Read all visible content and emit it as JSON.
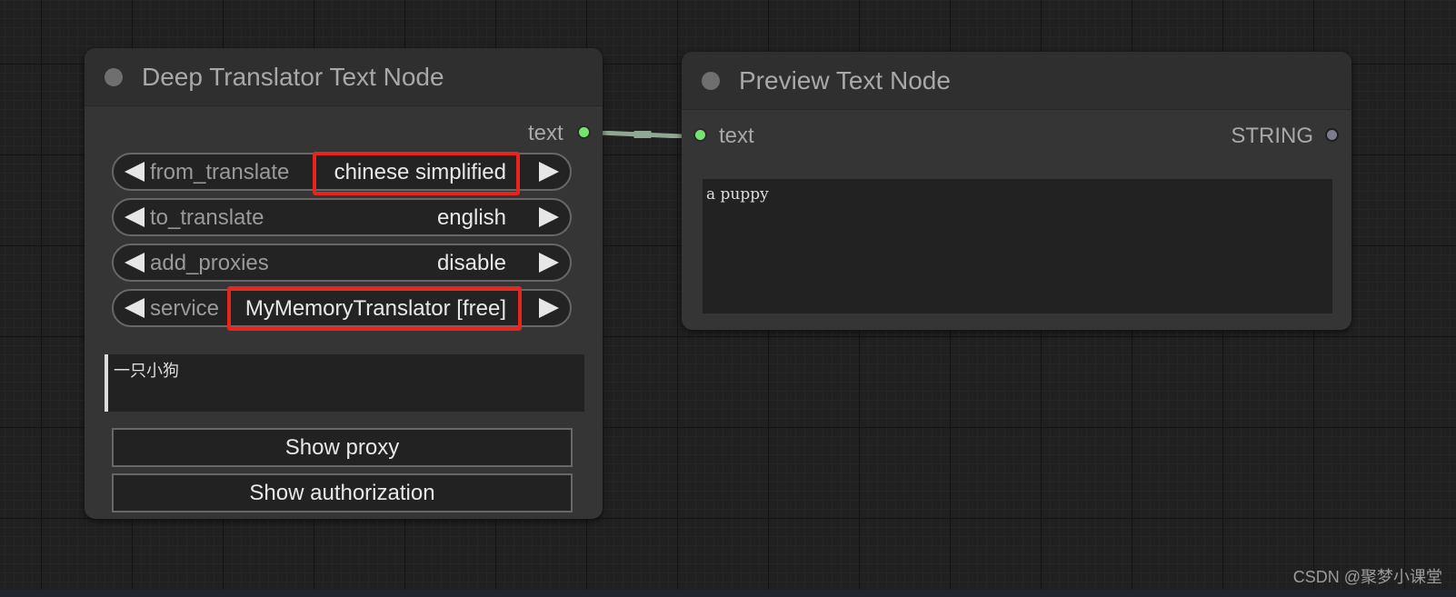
{
  "translator_node": {
    "title": "Deep Translator Text Node",
    "output_label": "text",
    "widgets": [
      {
        "label": "from_translate",
        "value": "chinese simplified"
      },
      {
        "label": "to_translate",
        "value": "english"
      },
      {
        "label": "add_proxies",
        "value": "disable"
      },
      {
        "label": "service",
        "value": "MyMemoryTranslator [free]"
      }
    ],
    "input_text": "一只小狗",
    "buttons": {
      "show_proxy": "Show proxy",
      "show_authorization": "Show authorization"
    }
  },
  "preview_node": {
    "title": "Preview Text Node",
    "input_label": "text",
    "output_label": "STRING",
    "preview_text": "a puppy"
  },
  "watermark": "CSDN @聚梦小课堂",
  "colors": {
    "highlight": "#e8251c",
    "slot_connected": "#74e36f",
    "slot_string": "#7c7d8a",
    "link": "#8fa893"
  }
}
